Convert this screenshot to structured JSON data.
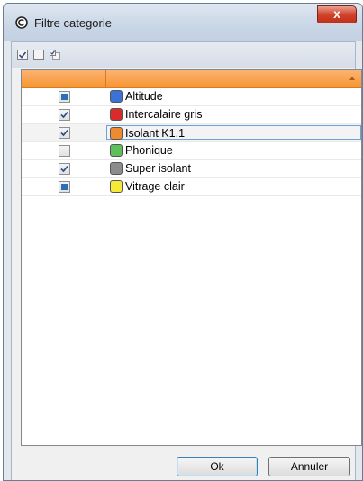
{
  "window": {
    "title": "Filtre categorie",
    "close_label": "x"
  },
  "toolbar": {
    "icons": [
      "check-all-icon",
      "uncheck-all-icon",
      "invert-selection-icon"
    ]
  },
  "grid": {
    "columns": [
      "",
      ""
    ],
    "sort": "ascending",
    "rows": [
      {
        "state": "partial",
        "label": "Altitude",
        "color": "#3b72d8"
      },
      {
        "state": "checked",
        "label": "Intercalaire gris",
        "color": "#d92b2b"
      },
      {
        "state": "checked",
        "label": "Isolant K1.1",
        "color": "#ef8a2f",
        "focused": true
      },
      {
        "state": "unchecked",
        "label": "Phonique",
        "color": "#5dc05a"
      },
      {
        "state": "checked",
        "label": "Super isolant",
        "color": "#8c8c8c"
      },
      {
        "state": "partial",
        "label": "Vitrage clair",
        "color": "#f5e93a"
      }
    ]
  },
  "buttons": {
    "ok": "Ok",
    "cancel": "Annuler"
  }
}
